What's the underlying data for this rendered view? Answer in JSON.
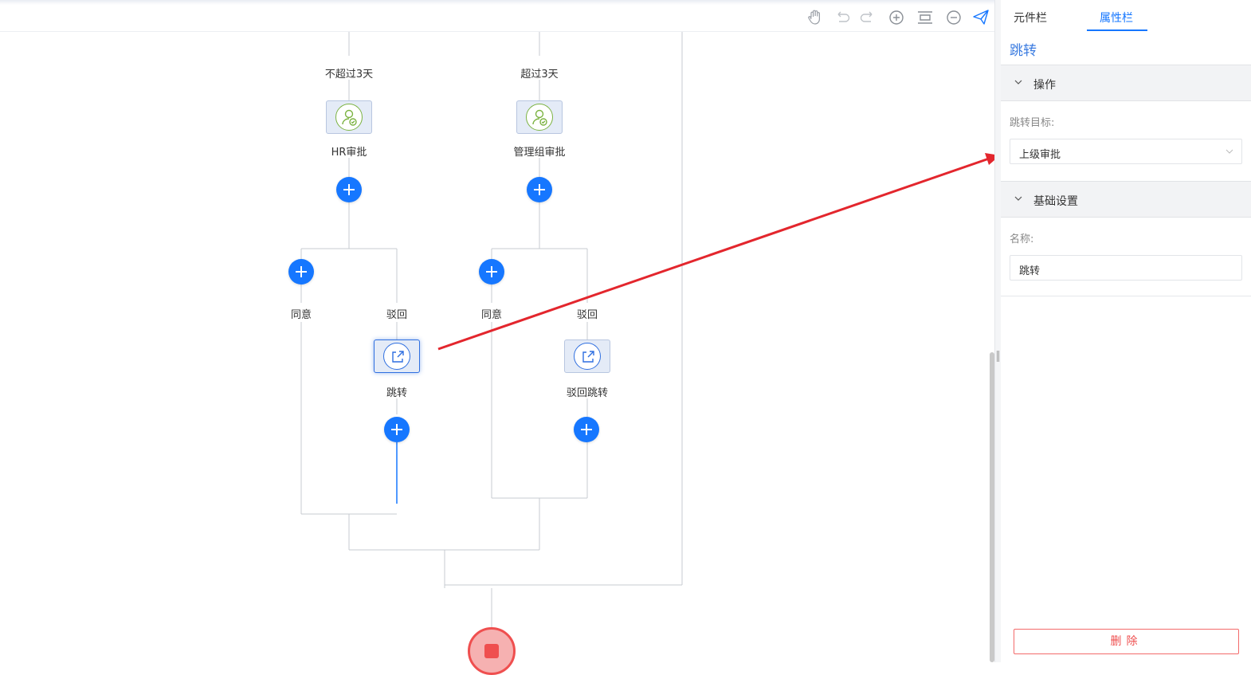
{
  "toolbar": {
    "icons": [
      "hand-icon",
      "undo-icon",
      "redo-icon",
      "zoom-in-icon",
      "fit-view-icon",
      "zoom-out-icon",
      "publish-icon"
    ]
  },
  "flow": {
    "branch_conditions": [
      "不超过3天",
      "超过3天"
    ],
    "approval_nodes": [
      "HR审批",
      "管理组审批"
    ],
    "outcomes": {
      "left": [
        "同意",
        "驳回"
      ],
      "right": [
        "同意",
        "驳回"
      ]
    },
    "jump_nodes": [
      "跳转",
      "驳回跳转"
    ]
  },
  "panel": {
    "tabs": [
      "元件栏",
      "属性栏"
    ],
    "active_tab": "属性栏",
    "title": "跳转",
    "operation_section": {
      "header": "操作",
      "jump_target_label": "跳转目标:",
      "jump_target_value": "上级审批"
    },
    "basic_section": {
      "header": "基础设置",
      "name_label": "名称:",
      "name_value": "跳转"
    },
    "delete_label": "删除"
  },
  "colors": {
    "accent": "#1677ff",
    "annotation_arrow": "#e3262d",
    "end_node": "#ef4f4f",
    "approval_icon": "#7cb342"
  }
}
